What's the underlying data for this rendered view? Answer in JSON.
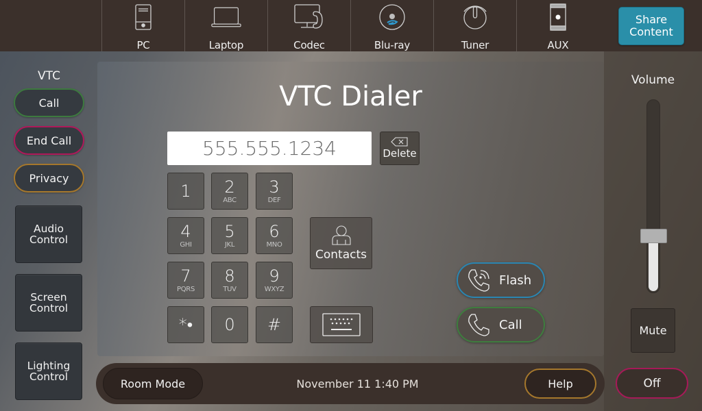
{
  "sources": [
    {
      "label": "PC",
      "icon": "desktop-tower-icon"
    },
    {
      "label": "Laptop",
      "icon": "laptop-icon"
    },
    {
      "label": "Codec",
      "icon": "codec-monitor-icon"
    },
    {
      "label": "Blu-ray",
      "icon": "bluray-disc-icon"
    },
    {
      "label": "Tuner",
      "icon": "tuner-knob-icon"
    },
    {
      "label": "AUX",
      "icon": "aux-phone-icon"
    }
  ],
  "share_content": "Share Content",
  "left": {
    "heading": "VTC",
    "call": "Call",
    "end_call": "End Call",
    "privacy": "Privacy",
    "audio_control": "Audio Control",
    "screen_control": "Screen Control",
    "lighting_control": "Lighting Control"
  },
  "dialer": {
    "title": "VTC Dialer",
    "number": "555.555.1234",
    "delete": "Delete",
    "keys": [
      {
        "digit": "1",
        "sub": ""
      },
      {
        "digit": "2",
        "sub": "ABC"
      },
      {
        "digit": "3",
        "sub": "DEF"
      },
      {
        "digit": "4",
        "sub": "GHI"
      },
      {
        "digit": "5",
        "sub": "JKL"
      },
      {
        "digit": "6",
        "sub": "MNO"
      },
      {
        "digit": "7",
        "sub": "PQRS"
      },
      {
        "digit": "8",
        "sub": "TUV"
      },
      {
        "digit": "9",
        "sub": "WXYZ"
      },
      {
        "digit": "*•",
        "sub": ""
      },
      {
        "digit": "0",
        "sub": ""
      },
      {
        "digit": "#",
        "sub": ""
      }
    ],
    "contacts": "Contacts",
    "flash": "Flash",
    "call": "Call"
  },
  "bottom": {
    "room_mode": "Room Mode",
    "datetime": "November 11 1:40 PM",
    "help": "Help"
  },
  "right": {
    "volume_label": "Volume",
    "volume_level": 0.28,
    "mute": "Mute",
    "off": "Off"
  },
  "colors": {
    "share_accent": "#2a8fa9",
    "call_green": "#3d7a3f",
    "end_red": "#b0185a",
    "privacy_gold": "#a6782c",
    "flash_blue": "#2a86b2"
  }
}
